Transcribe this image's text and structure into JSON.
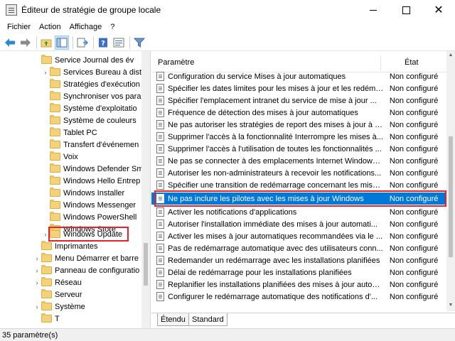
{
  "window": {
    "title": "Éditeur de stratégie de groupe locale",
    "close_glyph": "✕"
  },
  "menu": [
    "Fichier",
    "Action",
    "Affichage",
    "?"
  ],
  "toolbar": [
    "back-arrow-icon",
    "forward-arrow-icon",
    "up-folder-icon",
    "show-hide-tree-icon",
    "export-list-icon",
    "help-icon",
    "properties-icon",
    "filter-icon"
  ],
  "tree": {
    "items": [
      {
        "label": "Service Journal des év",
        "indent": 2
      },
      {
        "label": "Services Bureau à dist",
        "indent": 2
      },
      {
        "label": "Stratégies d'exécution",
        "indent": 2
      },
      {
        "label": "Synchroniser vos para",
        "indent": 2
      },
      {
        "label": "Système d'exploitatio",
        "indent": 2
      },
      {
        "label": "Système de couleurs",
        "indent": 2
      },
      {
        "label": "Tablet PC",
        "indent": 2
      },
      {
        "label": "Transfert d'événemen",
        "indent": 2
      },
      {
        "label": "Voix",
        "indent": 2
      },
      {
        "label": "Windows Defender Sm",
        "indent": 2
      },
      {
        "label": "Windows Hello Entrep",
        "indent": 2
      },
      {
        "label": "Windows Installer",
        "indent": 2
      },
      {
        "label": "Windows Messenger",
        "indent": 2
      },
      {
        "label": "Windows PowerShell",
        "indent": 2
      },
      {
        "label": "Windows Store",
        "indent": 2
      },
      {
        "label": "Windows Update",
        "indent": 2
      },
      {
        "label": "Imprimantes",
        "indent": 1
      },
      {
        "label": "Menu Démarrer et barre",
        "indent": 1
      },
      {
        "label": "Panneau de configuratio",
        "indent": 1
      },
      {
        "label": "Réseau",
        "indent": 1
      },
      {
        "label": "Serveur",
        "indent": 1
      },
      {
        "label": "Système",
        "indent": 1
      },
      {
        "label": "T",
        "indent": 1
      }
    ],
    "selected_index": 15
  },
  "list": {
    "col_param": "Paramètre",
    "col_state": "État",
    "rows": [
      {
        "name": "Configuration du service Mises à jour automatiques",
        "state": "Non configuré"
      },
      {
        "name": "Spécifier les dates limites pour les mises à jour et les redéma...",
        "state": "Non configuré"
      },
      {
        "name": "Spécifier l'emplacement intranet du service de mise à jour ...",
        "state": "Non configuré"
      },
      {
        "name": "Fréquence de détection des mises à jour automatiques",
        "state": "Non configuré"
      },
      {
        "name": "Ne pas autoriser les stratégies de report des mises à jour à é...",
        "state": "Non configuré"
      },
      {
        "name": "Supprimer l'accès à la fonctionnalité Interrompre les mises à...",
        "state": "Non configuré"
      },
      {
        "name": "Supprimer l'accès à l'utilisation de toutes les fonctionnalités ...",
        "state": "Non configuré"
      },
      {
        "name": "Ne pas se connecter à des emplacements Internet Windows ...",
        "state": "Non configuré"
      },
      {
        "name": "Autoriser les non-administrateurs à recevoir les notifications...",
        "state": "Non configuré"
      },
      {
        "name": "Spécifier une transition de redémarrage concernant les mises...",
        "state": "Non configuré"
      },
      {
        "name": "Ne pas inclure les pilotes avec les mises à jour Windows",
        "state": "Non configuré"
      },
      {
        "name": "Activer les notifications d'applications",
        "state": "Non configuré"
      },
      {
        "name": "Autoriser l'installation immédiate des mises à jour automati...",
        "state": "Non configuré"
      },
      {
        "name": "Activer les mises à jour automatiques recommandées via le ...",
        "state": "Non configuré"
      },
      {
        "name": "Pas de redémarrage automatique avec des utilisateurs conn...",
        "state": "Non configuré"
      },
      {
        "name": "Redemander un redémarrage avec les installations planifiées",
        "state": "Non configuré"
      },
      {
        "name": "Délai de redémarrage pour les installations planifiées",
        "state": "Non configuré"
      },
      {
        "name": "Replanifier les installations planifiées des mises à jour autom...",
        "state": "Non configuré"
      },
      {
        "name": "Configurer le redémarrage automatique des notifications d'...",
        "state": "Non configuré"
      }
    ],
    "selected_index": 10
  },
  "tabs": [
    "Étendu",
    "Standard"
  ],
  "active_tab": 1,
  "status": "35 paramètre(s)"
}
